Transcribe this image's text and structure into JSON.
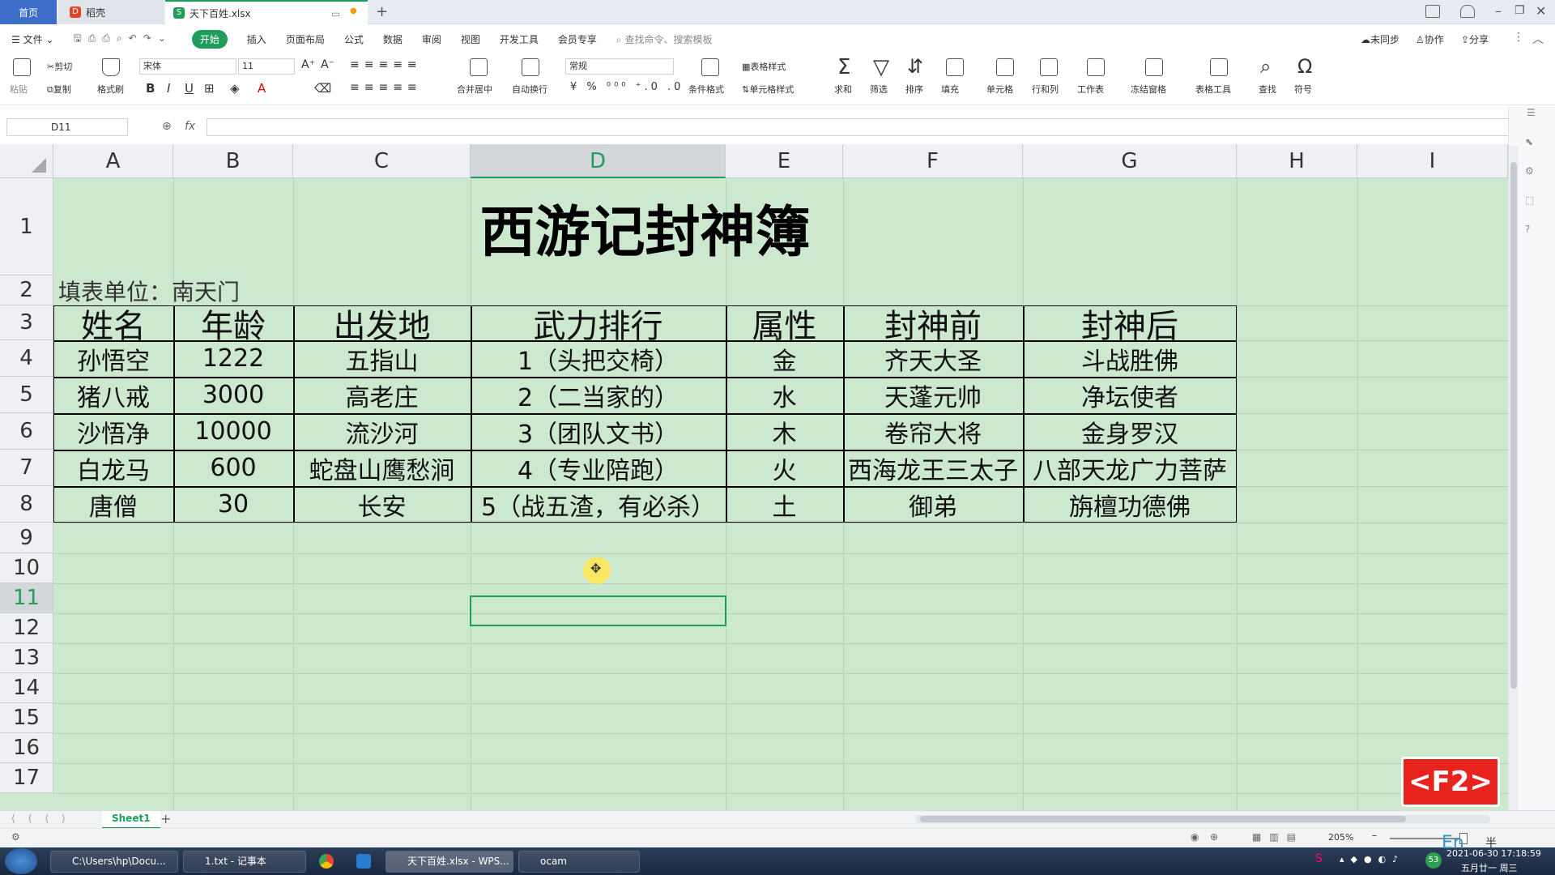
{
  "tabs": {
    "home": "首页",
    "daoke": "稻壳",
    "file": "天下百姓.xlsx"
  },
  "menu": {
    "file": "文件",
    "items": [
      "开始",
      "插入",
      "页面布局",
      "公式",
      "数据",
      "审阅",
      "视图",
      "开发工具",
      "会员专享"
    ],
    "search": "查找命令、搜索模板",
    "sync": "未同步",
    "collab": "协作",
    "share": "分享"
  },
  "ribbon": {
    "paste": "粘贴",
    "cut": "剪切",
    "copy": "复制",
    "format_painter": "格式刷",
    "font_name": "宋体",
    "font_size": "11",
    "merge": "合并居中",
    "wrap": "自动换行",
    "number_format": "常规",
    "conditional": "条件格式",
    "table_style": "表格样式",
    "cell_style": "单元格样式",
    "sum": "求和",
    "filter": "筛选",
    "sort": "排序",
    "fill": "填充",
    "cell": "单元格",
    "rowcol": "行和列",
    "worksheet": "工作表",
    "freeze": "冻结窗格",
    "table_tools": "表格工具",
    "find": "查找",
    "symbol": "符号"
  },
  "formula_bar": {
    "name_box": "D11",
    "fx": "fx",
    "content": ""
  },
  "columns": [
    "A",
    "B",
    "C",
    "D",
    "E",
    "F",
    "G",
    "H",
    "I"
  ],
  "rows": [
    "1",
    "2",
    "3",
    "4",
    "5",
    "6",
    "7",
    "8",
    "9",
    "10",
    "11",
    "12",
    "13",
    "14",
    "15",
    "16",
    "17"
  ],
  "sheet": {
    "title": "西游记封神簿",
    "unit": "填表单位：南天门",
    "headers": [
      "姓名",
      "年龄",
      "出发地",
      "武力排行",
      "属性",
      "封神前",
      "封神后"
    ],
    "records": [
      [
        "孙悟空",
        "1222",
        "五指山",
        "1（头把交椅）",
        "金",
        "齐天大圣",
        "斗战胜佛"
      ],
      [
        "猪八戒",
        "3000",
        "高老庄",
        "2（二当家的）",
        "水",
        "天蓬元帅",
        "净坛使者"
      ],
      [
        "沙悟净",
        "10000",
        "流沙河",
        "3（团队文书）",
        "木",
        "卷帘大将",
        "金身罗汉"
      ],
      [
        "白龙马",
        "600",
        "蛇盘山鹰愁涧",
        "4（专业陪跑）",
        "火",
        "西海龙王三太子",
        "八部天龙广力菩萨"
      ],
      [
        "唐僧",
        "30",
        "长安",
        "5（战五渣，有必杀）",
        "土",
        "御弟",
        "旃檀功德佛"
      ]
    ]
  },
  "sheet_tabs": {
    "active": "Sheet1",
    "add": "+"
  },
  "status": {
    "zoom": "205%",
    "mode_badge": "<F2>"
  },
  "taskbar": {
    "items": [
      "C:\\Users\\hp\\Docu...",
      "1.txt - 记事本",
      "天下百姓.xlsx - WPS...",
      "ocam"
    ],
    "time": "2021-06-30 17:18:59",
    "date": "五月廿一 周三",
    "ime": "En",
    "ime_extra": "半"
  }
}
